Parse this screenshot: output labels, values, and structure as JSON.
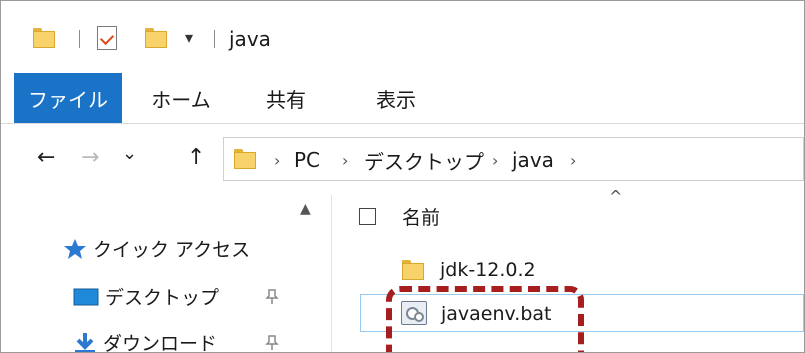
{
  "window": {
    "title": "java",
    "quick_access_dropdown": "▾"
  },
  "ribbon": {
    "tabs": [
      {
        "label": "ファイル",
        "active": true
      },
      {
        "label": "ホーム"
      },
      {
        "label": "共有"
      },
      {
        "label": "表示"
      }
    ]
  },
  "nav": {
    "back": "←",
    "forward": "→",
    "recent": "⌄",
    "up": "↑"
  },
  "address": {
    "crumbs": [
      "PC",
      "デスクトップ",
      "java"
    ],
    "separator": "›"
  },
  "sidebar": {
    "items": [
      {
        "label": "クイック アクセス",
        "icon": "star-icon"
      },
      {
        "label": "デスクトップ",
        "icon": "desktop-icon",
        "pinned": true
      },
      {
        "label": "ダウンロード",
        "icon": "download-icon",
        "pinned": true
      }
    ],
    "pin_glyph": "📌"
  },
  "content": {
    "column_name": "名前",
    "files": [
      {
        "name": "jdk-12.0.2",
        "icon": "folder-icon"
      },
      {
        "name": "javaenv.bat",
        "icon": "batch-file-icon",
        "selected": true
      }
    ]
  },
  "colors": {
    "accent": "#1a73c6",
    "highlight": "#a61e1e",
    "selection_border": "#99c9ef"
  }
}
